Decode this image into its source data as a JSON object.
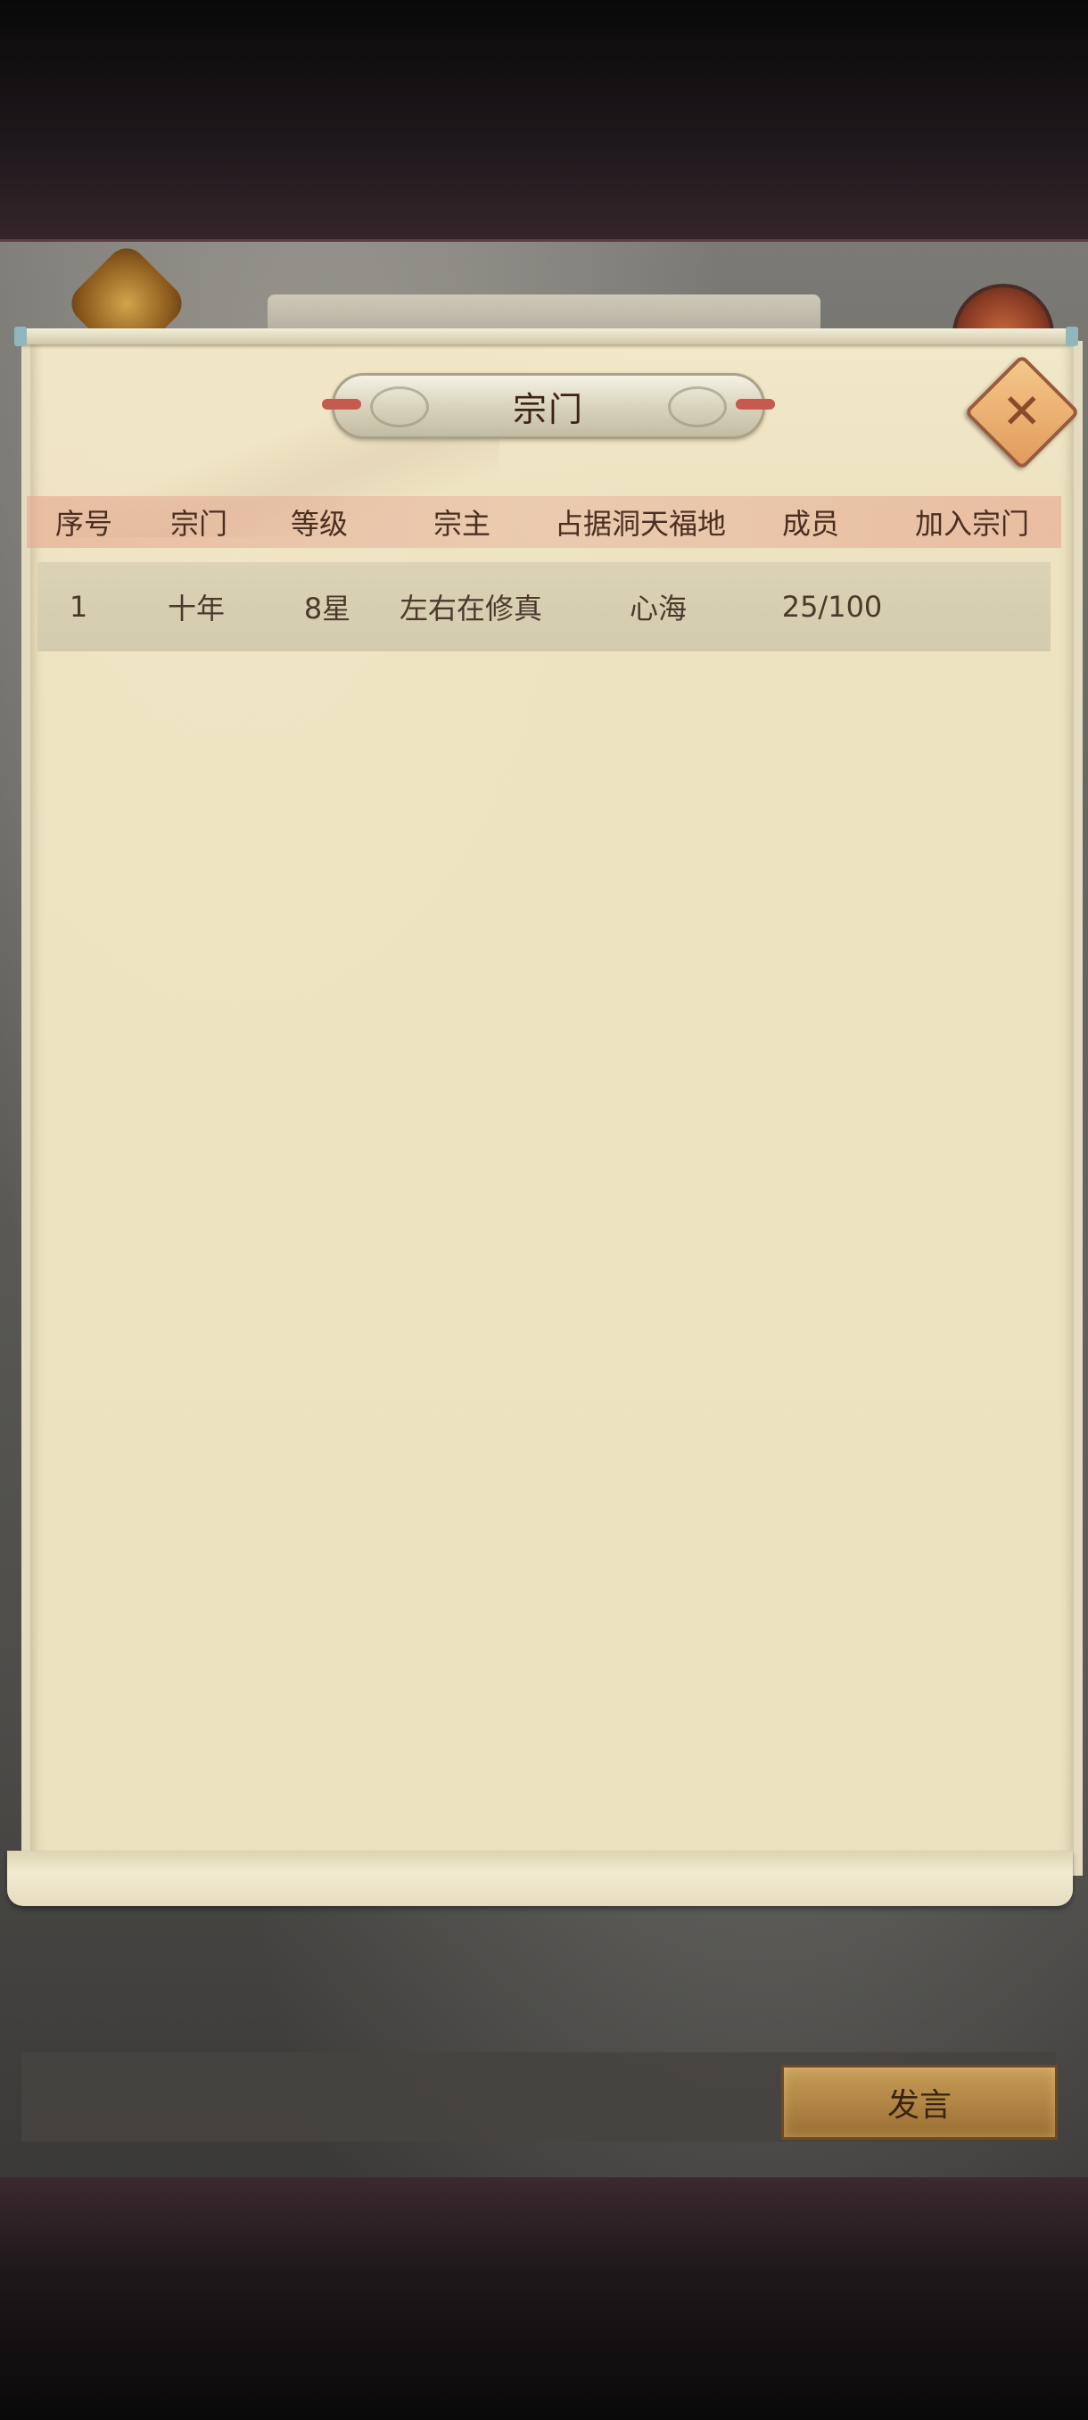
{
  "scene": {
    "banner_text": "十年"
  },
  "dialog": {
    "title": "宗门",
    "close_icon": "close-icon"
  },
  "table": {
    "headers": [
      "序号",
      "宗门",
      "等级",
      "宗主",
      "占据洞天福地",
      "成员",
      "加入宗门"
    ],
    "rows": [
      [
        "1",
        "十年",
        "8星",
        "左右在修真",
        "心海",
        "25/100",
        ""
      ]
    ]
  },
  "chat": {
    "input_value": "",
    "speak_label": "发言"
  },
  "colors": {
    "parchment": "#ece3c0",
    "header_band": "#e8b6a0",
    "close_button": "#e29b5b",
    "speak_button": "#b28645"
  }
}
